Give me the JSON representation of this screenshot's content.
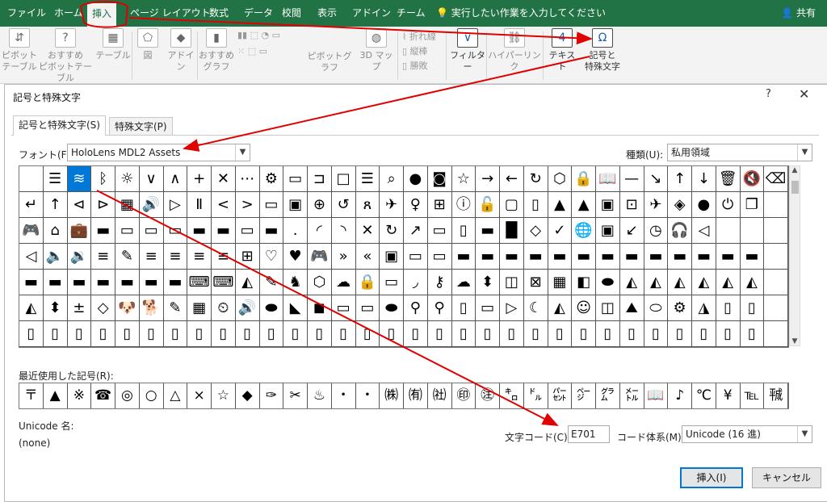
{
  "menu": {
    "tabs": [
      "ファイル",
      "ホーム",
      "挿入",
      "ページ レイアウト",
      "数式",
      "データ",
      "校閲",
      "表示",
      "アドイン",
      "チーム"
    ],
    "active_tab": "挿入",
    "tell_me": "実行したい作業を入力してください",
    "share": "共有"
  },
  "ribbon": {
    "pivot_table": [
      "ピボット",
      "テーブル"
    ],
    "recommended_pivot": [
      "おすすめ",
      "ピボットテーブル"
    ],
    "table": "テーブル",
    "illustrations": "図",
    "addins": [
      "アドイ",
      "ン"
    ],
    "recommended_charts": [
      "おすすめ",
      "グラフ"
    ],
    "pivot_chart": "ピボットグラフ",
    "map_3d": [
      "3D マッ",
      "プ"
    ],
    "sparkline_line": "折れ線",
    "sparkline_column": "縦棒",
    "sparkline_winloss": "勝敗",
    "filter": "フィルター",
    "hyperlink": "ハイパーリンク",
    "text": "テキスト",
    "symbols": [
      "記号と",
      "特殊文字"
    ]
  },
  "dialog": {
    "title": "記号と特殊文字",
    "help": "?",
    "close": "✕",
    "tabs": [
      "記号と特殊文字(S)",
      "特殊文字(P)"
    ],
    "font_label": "フォント(F):",
    "font_value": "HoloLens MDL2 Assets",
    "subset_label": "種類(U):",
    "subset_value": "私用領域",
    "recent_label": "最近使用した記号(R):",
    "unicode_name_label": "Unicode 名:",
    "unicode_name_value": "(none)",
    "char_code_label": "文字コード(C):",
    "char_code_value": "E701",
    "from_label": "コード体系(M):",
    "from_value": "Unicode (16 進)",
    "insert_button": "挿入(I)",
    "cancel_button": "キャンセル"
  },
  "symbol_rows": [
    [
      " ",
      "☰",
      "≋",
      "ᛒ",
      "☼",
      "∨",
      "∧",
      "+",
      "✕",
      "⋯",
      "⚙",
      "▭",
      "⊐",
      "□",
      "☰",
      "⌕",
      "●",
      "◙",
      "☆",
      "→",
      "←",
      "↻",
      "⬡",
      "🔒",
      "📖",
      "—",
      "↘",
      "↑",
      "↓",
      "🗑",
      "🔇",
      "⌫"
    ],
    [
      "↵",
      "↑",
      "⊲",
      "⊳",
      "▦",
      "🔊",
      "▷",
      "Ⅱ",
      "<",
      ">",
      "▭",
      "▣",
      "⊕",
      "↺",
      "ጸ",
      "✈",
      "♀",
      "⊞",
      "ⓘ",
      "🔓",
      "▢",
      "▯",
      "▲",
      "▲",
      "▣",
      "⊡",
      "✈",
      "◈",
      "●",
      "⏻",
      "❐",
      " "
    ],
    [
      "🎮",
      "⌂",
      "💼",
      "▬",
      "▭",
      "▭",
      "▭",
      "▬",
      "▬",
      "▭",
      "▬",
      ".",
      "◜",
      "◝",
      "✕",
      "↻",
      "↗",
      "▭",
      "▯",
      "▬",
      "█",
      "◇",
      "✓",
      "🌐",
      "▣",
      "↙",
      "◷",
      "🎧",
      "◁",
      " ",
      " ",
      " "
    ],
    [
      "◁",
      "🔈",
      "🔉",
      "≡",
      "✎",
      "≡",
      "≡",
      "≡",
      "≡",
      "⊞",
      "♡",
      "♥",
      "🎮",
      "»",
      "«",
      "▣",
      "▭",
      "▭",
      "▬",
      "▬",
      "▬",
      "▬",
      "▬",
      "▬",
      "▬",
      "▬",
      "▬",
      "▬",
      "▬",
      "▬",
      "▬",
      " "
    ],
    [
      "▬",
      "▬",
      "▬",
      "▬",
      "▬",
      "▬",
      "▬",
      "⌨",
      "⌨",
      "◭",
      "✎",
      "♞",
      "⬡",
      "☁",
      "🔒",
      "▭",
      "◞",
      "⚷",
      "☁",
      "⬍",
      "◫",
      "⊠",
      "▦",
      "◧",
      "⬬",
      "◭",
      "◭",
      "◭",
      "◭",
      "◭",
      "◭",
      " "
    ],
    [
      "◭",
      "⬍",
      "±",
      "◇",
      "🐶",
      "🐕",
      "✎",
      "▦",
      "⏲",
      "🔊",
      "⬬",
      "◣",
      "◼",
      "▭",
      "▭",
      "⬬",
      "⚲",
      "⚲",
      "▯",
      "▭",
      "▷",
      "☾",
      "◭",
      "☺",
      "◫",
      "⛰",
      "⬭",
      "⚙",
      "◮",
      "▯",
      "▯",
      " "
    ],
    [
      "▯",
      "▯",
      "▯",
      "▯",
      "▯",
      "▯",
      "▯",
      "▯",
      "▯",
      "▯",
      "▯",
      "▯",
      "▯",
      "▯",
      "▯",
      "▯",
      "▯",
      "▯",
      "▯",
      "▯",
      "▯",
      "▯",
      "▯",
      "▯",
      "▯",
      "▯",
      "▯",
      "▯",
      "▯",
      "▯",
      "▯",
      " "
    ]
  ],
  "recent_symbols": [
    "〒",
    "▲",
    "※",
    "☎",
    "◎",
    "○",
    "△",
    "×",
    "☆",
    "◆",
    "✑",
    "✂",
    "♨",
    "・",
    "・",
    "㈱",
    "㈲",
    "㈳",
    "㊞",
    "㊟",
    "㌔",
    "㌦",
    "㌫",
    "㌻",
    "㌘",
    "㍍",
    "📖",
    "♪",
    "℃",
    "¥",
    "℡",
    "㍻"
  ],
  "colors": {
    "excel_green": "#217346",
    "selection_blue": "#0078d7",
    "annotation_red": "#e00000"
  }
}
